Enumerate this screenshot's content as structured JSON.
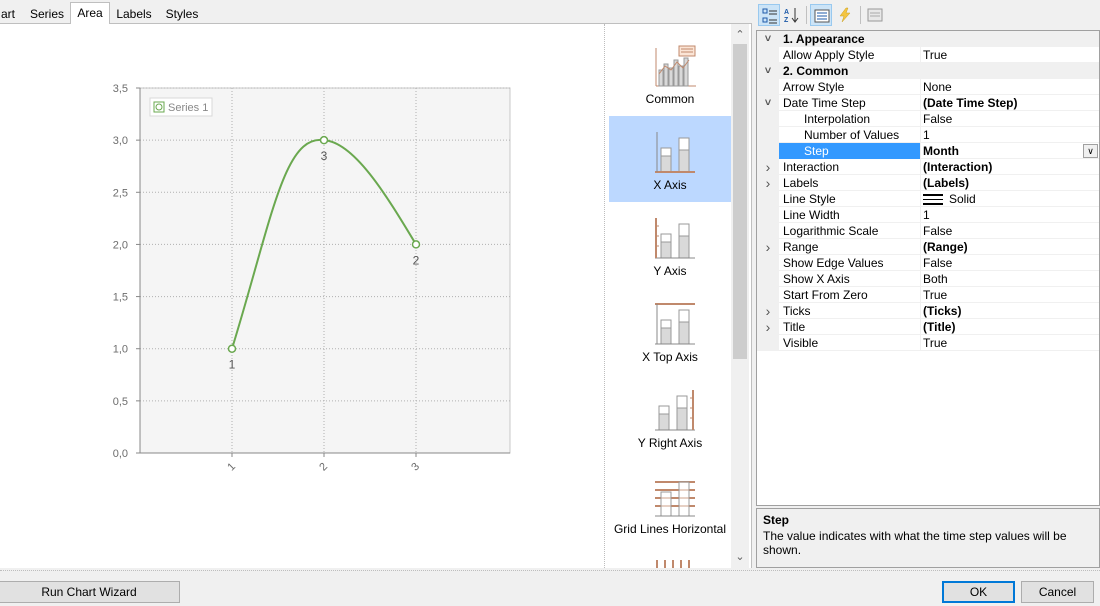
{
  "tabs": [
    {
      "label": "art"
    },
    {
      "label": "Series"
    },
    {
      "label": "Area"
    },
    {
      "label": "Labels"
    },
    {
      "label": "Styles"
    }
  ],
  "active_tab": "Area",
  "chart_data": {
    "type": "line",
    "x": [
      "1",
      "2",
      "3"
    ],
    "series": [
      {
        "name": "Series 1",
        "values": [
          1.0,
          3.0,
          2.0
        ],
        "point_labels": [
          "1",
          "3",
          "2"
        ],
        "color": "#6aa84f"
      }
    ],
    "ylim": [
      0,
      3.5
    ],
    "y_ticks": [
      "0,0",
      "0,5",
      "1,0",
      "1,5",
      "2,0",
      "2,5",
      "3,0",
      "3,5"
    ],
    "x_ticks": [
      "1",
      "2",
      "3"
    ],
    "grid": true,
    "legend": "top-left",
    "xlabel": "",
    "ylabel": "",
    "title": ""
  },
  "gallery": {
    "items": [
      {
        "label": "Common",
        "icon": "common-chart-icon"
      },
      {
        "label": "X Axis",
        "icon": "x-axis-icon",
        "selected": true
      },
      {
        "label": "Y Axis",
        "icon": "y-axis-icon"
      },
      {
        "label": "X Top Axis",
        "icon": "x-top-axis-icon"
      },
      {
        "label": "Y Right Axis",
        "icon": "y-right-axis-icon"
      },
      {
        "label": "Grid Lines Horizontal",
        "icon": "grid-lines-horizontal-icon"
      }
    ]
  },
  "property_grid": {
    "toolbar": [
      "categorized-icon",
      "alphabetical-icon",
      "properties-icon",
      "events-icon",
      "property-pages-icon"
    ],
    "rows": [
      {
        "type": "cat",
        "name": "1. Appearance",
        "expander": "v"
      },
      {
        "name": "Allow Apply Style",
        "value": "True"
      },
      {
        "type": "cat",
        "name": "2. Common",
        "expander": "v"
      },
      {
        "name": "Arrow Style",
        "value": "None"
      },
      {
        "name": "Date Time Step",
        "value": "(Date Time Step)",
        "bold": true,
        "expander": "v"
      },
      {
        "name": "Interpolation",
        "value": "False",
        "indent": true
      },
      {
        "name": "Number of Values",
        "value": "1",
        "indent": true
      },
      {
        "name": "Step",
        "value": "Month",
        "indent": true,
        "bold": true,
        "selected": true,
        "dropdown": true
      },
      {
        "name": "Interaction",
        "value": "(Interaction)",
        "bold": true,
        "expander": ">"
      },
      {
        "name": "Labels",
        "value": "(Labels)",
        "bold": true,
        "expander": ">"
      },
      {
        "name": "Line Style",
        "value": "Solid",
        "swatch": true
      },
      {
        "name": "Line Width",
        "value": "1"
      },
      {
        "name": "Logarithmic Scale",
        "value": "False"
      },
      {
        "name": "Range",
        "value": "(Range)",
        "bold": true,
        "expander": ">"
      },
      {
        "name": "Show Edge Values",
        "value": "False"
      },
      {
        "name": "Show X Axis",
        "value": "Both"
      },
      {
        "name": "Start From Zero",
        "value": "True"
      },
      {
        "name": "Ticks",
        "value": "(Ticks)",
        "bold": true,
        "expander": ">"
      },
      {
        "name": "Title",
        "value": "(Title)",
        "bold": true,
        "expander": ">"
      },
      {
        "name": "Visible",
        "value": "True"
      }
    ],
    "help": {
      "title": "Step",
      "description": "The value indicates with what the time step values will be shown."
    }
  },
  "buttons": {
    "wizard": "Run Chart Wizard",
    "ok": "OK",
    "cancel": "Cancel"
  }
}
